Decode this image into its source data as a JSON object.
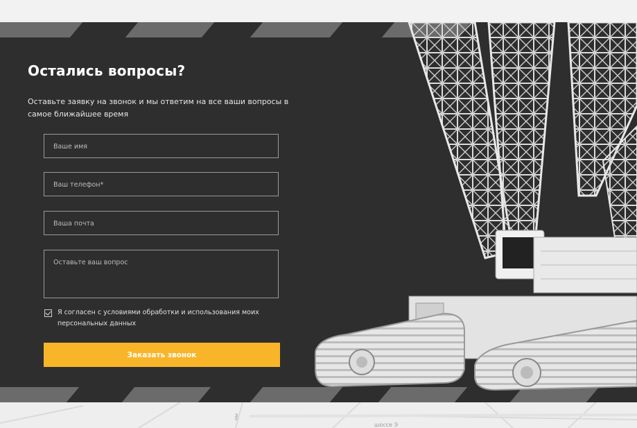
{
  "callback_form": {
    "title": "Остались вопросы?",
    "subtitle": "Оставьте заявку на звонок и мы ответим на все ваши вопросы в самое ближайшее время",
    "fields": {
      "name_placeholder": "Ваше имя",
      "phone_placeholder": "Ваш телефон*",
      "email_placeholder": "Ваша почта",
      "question_placeholder": "Оставьте ваш вопрос"
    },
    "consent_text": "Я согласен с условиями обработки и использования моих персональных данных",
    "consent_checked": true,
    "submit_label": "Заказать звонок"
  },
  "map": {
    "street_label": "шоссе Э",
    "side_label": "ны"
  },
  "colors": {
    "section_bg": "#2e2e2e",
    "stripe": "#6b6b6b",
    "accent": "#f9b529",
    "field_border": "#9a9a9a"
  },
  "icons": {
    "crane_image": "crawler-crane-illustration",
    "checkbox": "checkmark-icon"
  }
}
